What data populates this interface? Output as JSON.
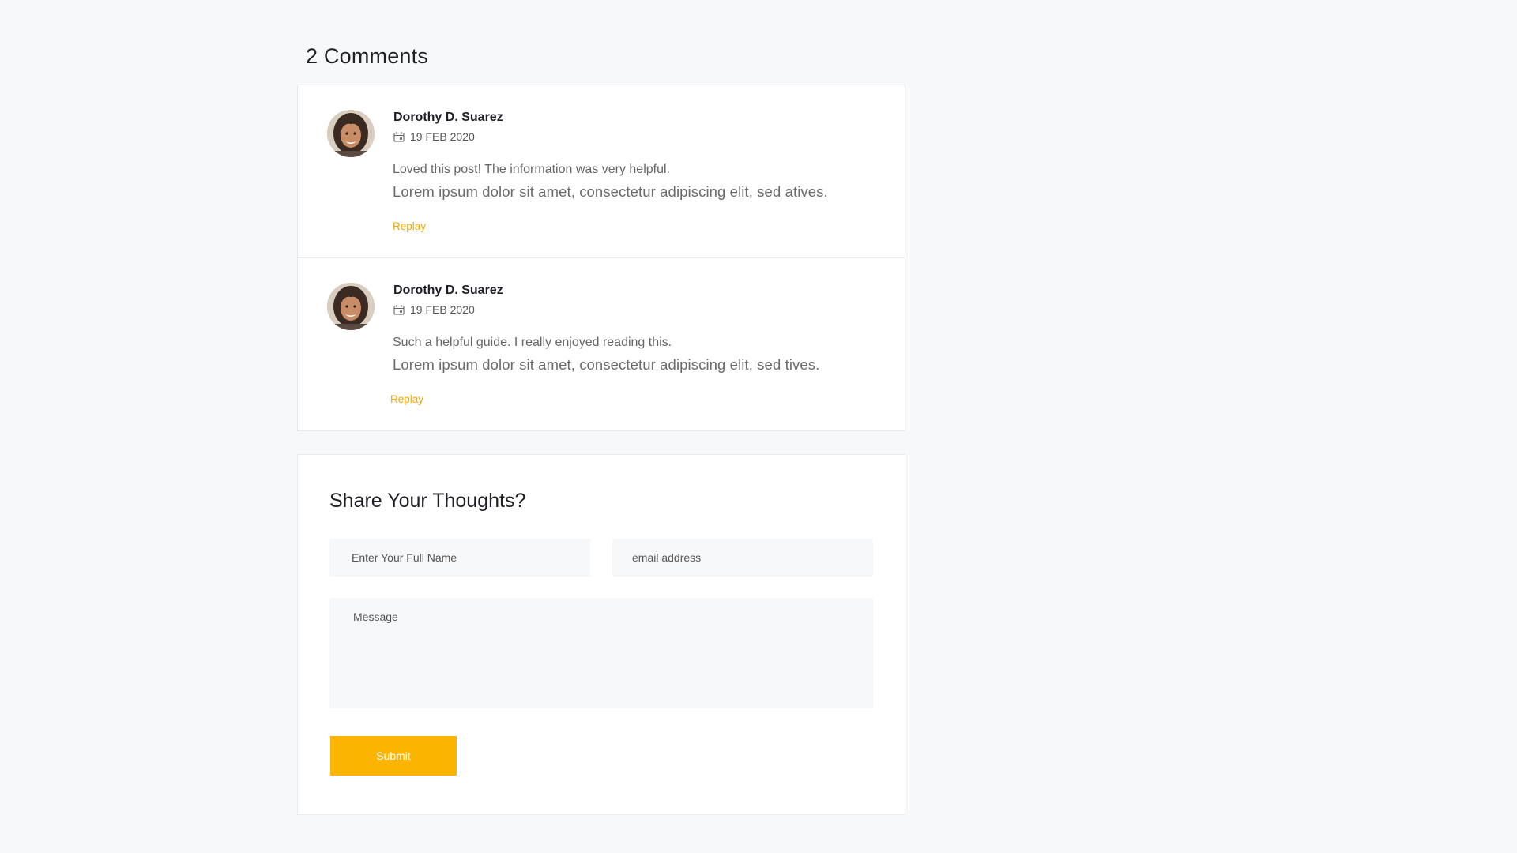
{
  "comments_section": {
    "title": "2 Comments",
    "items": [
      {
        "author": "Dorothy D. Suarez",
        "date": "19 FEB 2020",
        "text_primary": "Loved this post! The information was very helpful.",
        "text_secondary": "Lorem ipsum dolor sit amet, consectetur adipiscing elit, sed atives.",
        "reply_label": "Replay",
        "avatar_icon": "woman-portrait-avatar",
        "date_icon": "calendar-icon"
      },
      {
        "author": "Dorothy D. Suarez",
        "date": "19 FEB 2020",
        "text_primary": "Such a helpful guide. I really enjoyed reading this.",
        "text_secondary": "Lorem ipsum dolor sit amet, consectetur adipiscing elit, sed tives.",
        "reply_label": "Replay",
        "avatar_icon": "woman-portrait-avatar",
        "date_icon": "calendar-icon"
      }
    ]
  },
  "comment_form": {
    "title": "Share Your Thoughts?",
    "name_placeholder": "Enter Your Full Name",
    "email_placeholder": "email address",
    "message_placeholder": "Message",
    "submit_label": "Submit"
  },
  "colors": {
    "accent": "#fbb400",
    "reply_link": "#f2a800",
    "page_background": "#f7f8fa",
    "input_background": "#f7f8fa",
    "card_background": "#ffffff"
  }
}
